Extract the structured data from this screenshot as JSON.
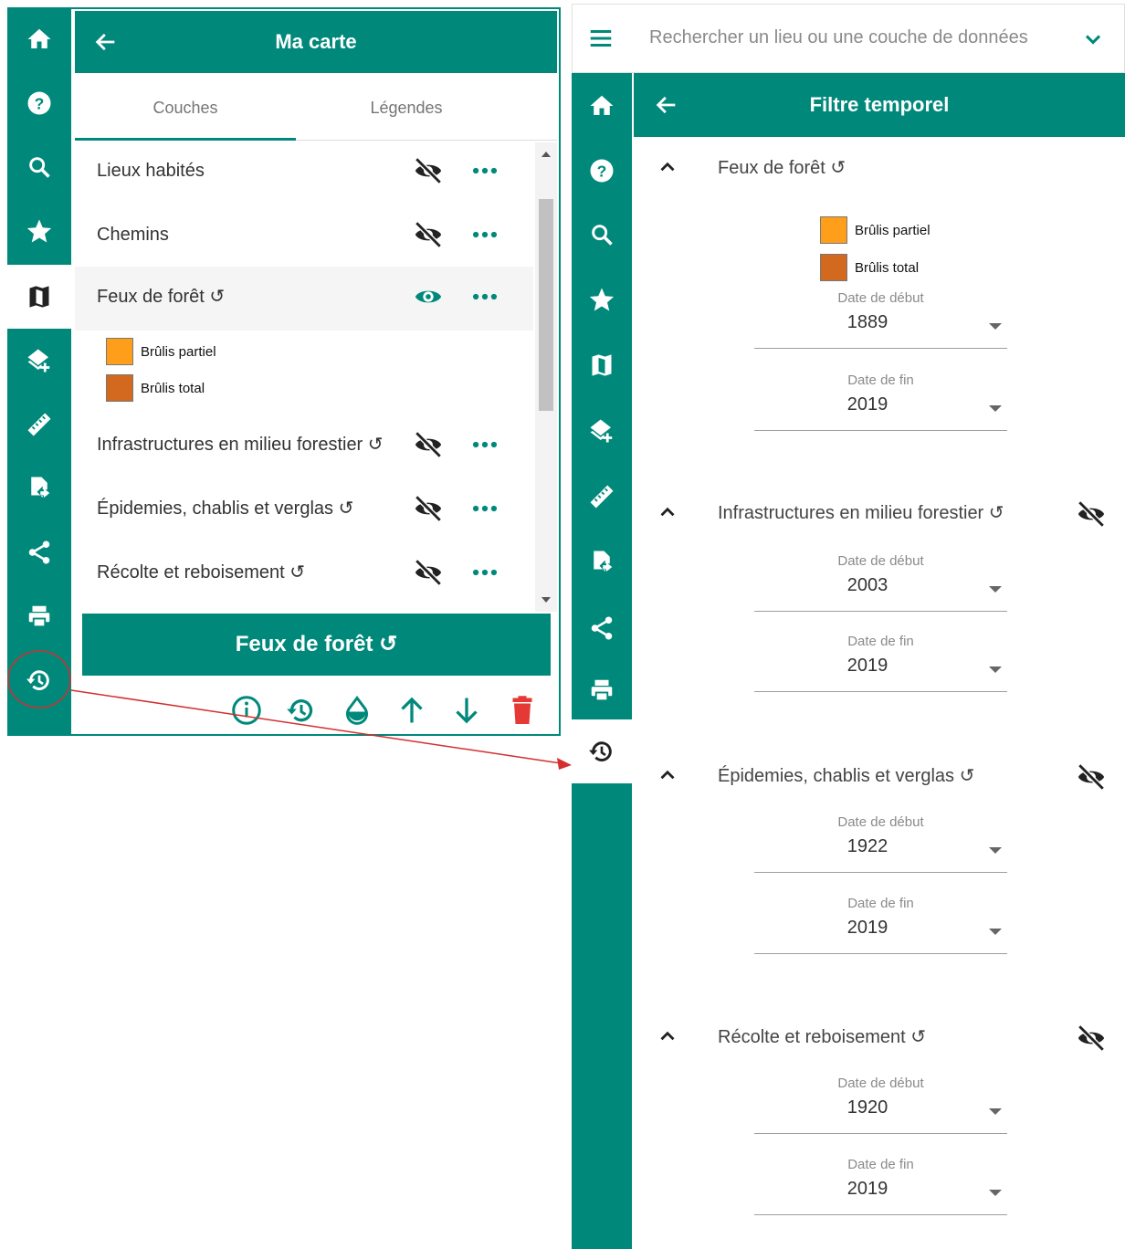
{
  "colors": {
    "primary": "#00897b",
    "legend_partial": "#ff9e1b",
    "legend_total": "#d2691e",
    "delete": "#e53935",
    "annotation": "#d32f2f"
  },
  "left_panel": {
    "title": "Ma carte",
    "tabs": [
      "Couches",
      "Légendes"
    ],
    "layers": [
      {
        "label": "Lieux habités",
        "visible": false
      },
      {
        "label": "Chemins",
        "visible": false
      },
      {
        "label": "Feux de forêt ↺",
        "visible": true
      },
      {
        "label": "Infrastructures en milieu forestier ↺",
        "visible": false
      },
      {
        "label": "Épidemies, chablis et verglas ↺",
        "visible": false
      },
      {
        "label": "Récolte et reboisement ↺",
        "visible": false
      }
    ],
    "legend": [
      {
        "label": "Brûlis partiel",
        "color": "#ff9e1b"
      },
      {
        "label": "Brûlis total",
        "color": "#d2691e"
      }
    ],
    "selected_layer": "Feux de forêt ↺",
    "tools": [
      "info-icon",
      "history-icon",
      "opacity-icon",
      "arrow-up-icon",
      "arrow-down-icon",
      "trash-icon"
    ]
  },
  "right_panel": {
    "search_placeholder": "Rechercher un lieu ou une couche de données",
    "title": "Filtre temporel",
    "sections": [
      {
        "label": "Feux de forêt ↺",
        "legend": [
          {
            "label": "Brûlis partiel",
            "color": "#ff9e1b"
          },
          {
            "label": "Brûlis total",
            "color": "#d2691e"
          }
        ],
        "start_label": "Date de début",
        "start": "1889",
        "end_label": "Date de fin",
        "end": "2019"
      },
      {
        "label": "Infrastructures en milieu forestier ↺",
        "start_label": "Date de début",
        "start": "2003",
        "end_label": "Date de fin",
        "end": "2019"
      },
      {
        "label": "Épidemies, chablis et verglas ↺",
        "start_label": "Date de début",
        "start": "1922",
        "end_label": "Date de fin",
        "end": "2019"
      },
      {
        "label": "Récolte et reboisement ↺",
        "start_label": "Date de début",
        "start": "1920",
        "end_label": "Date de fin",
        "end": "2019"
      }
    ]
  },
  "rail_icons": [
    "home-icon",
    "help-icon",
    "search-icon",
    "star-icon",
    "map-icon",
    "add-layer-icon",
    "ruler-icon",
    "import-icon",
    "share-icon",
    "print-icon",
    "history-icon"
  ]
}
